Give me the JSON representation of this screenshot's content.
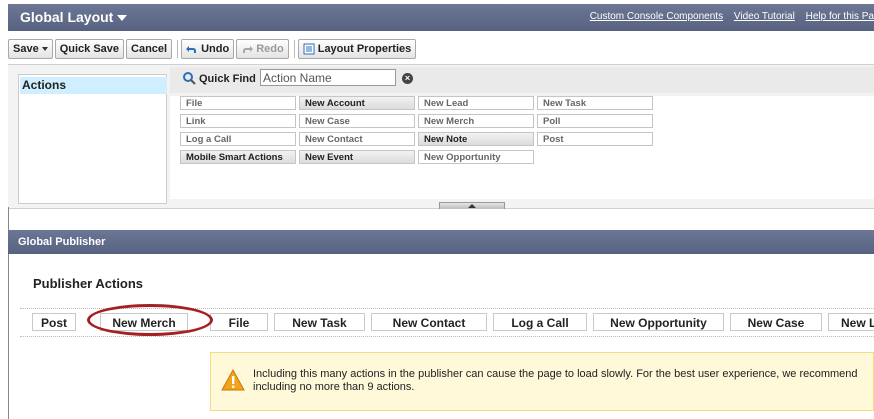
{
  "header": {
    "title": "Global Layout",
    "links": [
      "Custom Console Components",
      "Video Tutorial",
      "Help for this Pa"
    ]
  },
  "toolbar": {
    "save": "Save",
    "quick_save": "Quick Save",
    "cancel": "Cancel",
    "undo": "Undo",
    "redo": "Redo",
    "layout_properties": "Layout Properties"
  },
  "palette": {
    "categories": [
      "Actions"
    ],
    "quick_find_label": "Quick Find",
    "quick_find_placeholder": "Action Name",
    "items": [
      {
        "label": "File",
        "in_use": false
      },
      {
        "label": "New Account",
        "in_use": true
      },
      {
        "label": "New Lead",
        "in_use": false
      },
      {
        "label": "New Task",
        "in_use": false
      },
      {
        "label": "Link",
        "in_use": false
      },
      {
        "label": "New Case",
        "in_use": false
      },
      {
        "label": "New Merch",
        "in_use": false
      },
      {
        "label": "Poll",
        "in_use": false
      },
      {
        "label": "Log a Call",
        "in_use": false
      },
      {
        "label": "New Contact",
        "in_use": false
      },
      {
        "label": "New Note",
        "in_use": true
      },
      {
        "label": "Post",
        "in_use": false
      },
      {
        "label": "Mobile Smart Actions",
        "in_use": true
      },
      {
        "label": "New Event",
        "in_use": true
      },
      {
        "label": "New Opportunity",
        "in_use": false
      }
    ]
  },
  "publisher": {
    "section_title": "Global Publisher",
    "actions_title": "Publisher Actions",
    "actions": [
      "Post",
      "New Merch",
      "File",
      "New Task",
      "New Contact",
      "Log a Call",
      "New Opportunity",
      "New Case",
      "New Le"
    ],
    "highlighted_action": "New Merch"
  },
  "warning": {
    "text": "Including this many actions in the publisher can cause the page to load slowly. For the best user experience, we recommend including no more than 9 actions."
  },
  "colors": {
    "header_bg": "#5d6986",
    "selected_category": "#cfeeff",
    "highlight_oval": "#a52020",
    "warning_bg": "#fff8d9"
  }
}
